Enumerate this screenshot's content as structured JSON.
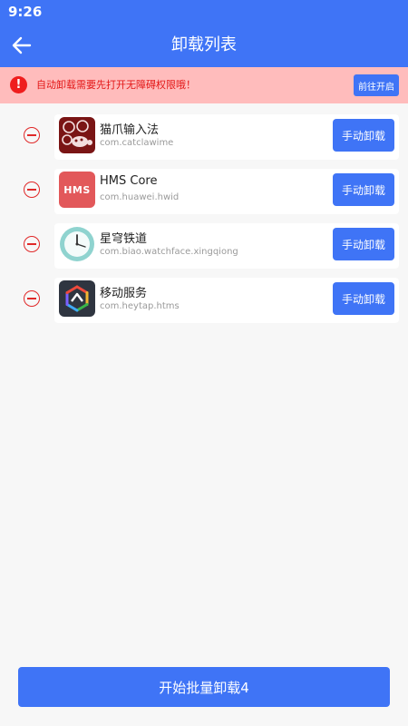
{
  "status_bar": {
    "time": "9:26"
  },
  "header": {
    "title": "卸载列表"
  },
  "warning": {
    "text": "自动卸载需要先打开无障碍权限哦！",
    "action_label": "前往开启"
  },
  "apps": [
    {
      "name": "猫爪输入法",
      "package": "com.catclawime",
      "button_label": "手动卸载"
    },
    {
      "name": "HMS Core",
      "package": "com.huawei.hwid",
      "button_label": "手动卸载",
      "icon_text": "HMS"
    },
    {
      "name": "星穹铁道",
      "package": "com.biao.watchface.xingqiong",
      "button_label": "手动卸载"
    },
    {
      "name": "移动服务",
      "package": "com.heytap.htms",
      "button_label": "手动卸载"
    }
  ],
  "footer": {
    "batch_label": "开始批量卸载4"
  },
  "colors": {
    "primary": "#3f74f6",
    "warning_bg": "#ffbcbc",
    "warning_text": "#e31616"
  }
}
